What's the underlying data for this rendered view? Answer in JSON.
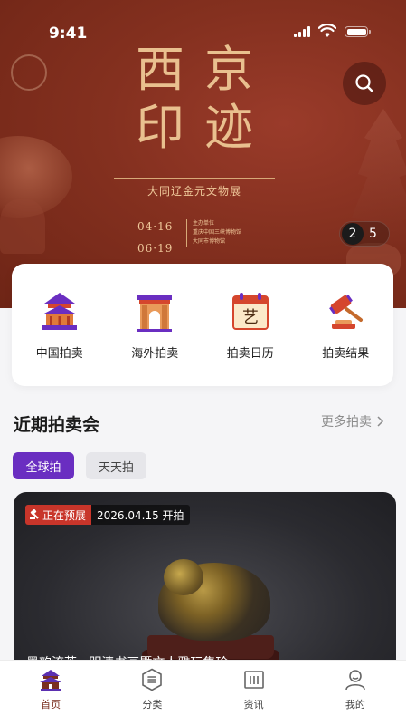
{
  "status_bar": {
    "time": "9:41"
  },
  "banner": {
    "title_chars": [
      "西",
      "京",
      "印",
      "迹"
    ],
    "subtitle": "大同辽金元文物展",
    "date_start": "04·16",
    "date_end": "06·19",
    "org_lines": [
      "主办单位",
      "重庆中国三峡博物馆",
      "大同市博物馆"
    ],
    "pager_current": "2",
    "pager_total": "5"
  },
  "categories": [
    {
      "label": "中国拍卖",
      "icon": "temple-icon"
    },
    {
      "label": "海外拍卖",
      "icon": "arch-icon"
    },
    {
      "label": "拍卖日历",
      "icon": "calendar-icon"
    },
    {
      "label": "拍卖结果",
      "icon": "gavel-icon"
    }
  ],
  "section": {
    "title": "近期拍卖会",
    "more": "更多拍卖"
  },
  "filters": {
    "global": "全球拍",
    "daily": "天天拍"
  },
  "auction_card": {
    "status": "正在预展",
    "start_text": "2026.04.15 开拍",
    "caption": "墨韵流芳 · 明清书画暨文人雅玩集珍"
  },
  "tabbar": [
    {
      "label": "首页",
      "icon": "home-pavilion-icon",
      "active": true
    },
    {
      "label": "分类",
      "icon": "category-icon",
      "active": false
    },
    {
      "label": "资讯",
      "icon": "news-icon",
      "active": false
    },
    {
      "label": "我的",
      "icon": "profile-icon",
      "active": false
    }
  ],
  "colors": {
    "accent": "#6a2ec1",
    "banner": "#84301f",
    "live_badge": "#c8352a"
  }
}
